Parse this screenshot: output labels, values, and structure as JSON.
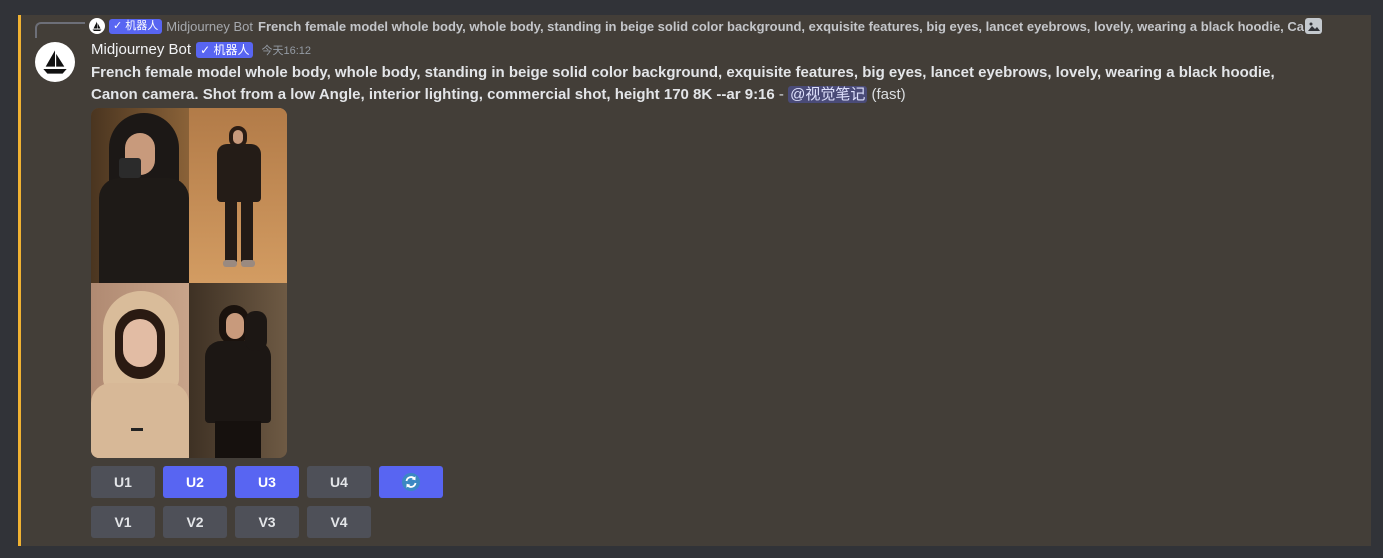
{
  "reply": {
    "badge": "✓ 机器人",
    "author": "Midjourney Bot",
    "text": "French female model whole body, whole body, standing in beige solid color background, exquisite features, big eyes, lancet eyebrows, lovely, wearing a black hoodie, Ca"
  },
  "message": {
    "author": "Midjourney Bot",
    "badge": "✓ 机器人",
    "timestamp": "今天16:12",
    "prompt": "French female model whole body, whole body, standing in beige solid color background, exquisite features, big eyes, lancet eyebrows, lovely, wearing a black hoodie, Canon camera. Shot from a low Angle, interior lighting, commercial shot, height 170 8K --ar 9:16",
    "separator": " - ",
    "mention": "@视觉笔记",
    "mode": " (fast)"
  },
  "image_grid": [
    "model-hood-close",
    "model-full-body",
    "model-beige-hood",
    "model-black-hoodie"
  ],
  "buttons": {
    "upscale": [
      {
        "label": "U1",
        "active": false
      },
      {
        "label": "U2",
        "active": true
      },
      {
        "label": "U3",
        "active": true
      },
      {
        "label": "U4",
        "active": false
      }
    ],
    "reroll_icon": "refresh-icon",
    "variation": [
      {
        "label": "V1"
      },
      {
        "label": "V2"
      },
      {
        "label": "V3"
      },
      {
        "label": "V4"
      }
    ]
  },
  "colors": {
    "accent_border": "#f0b232",
    "button_primary": "#5865f2",
    "button_secondary": "#4e5058",
    "message_bg": "#433e38"
  }
}
